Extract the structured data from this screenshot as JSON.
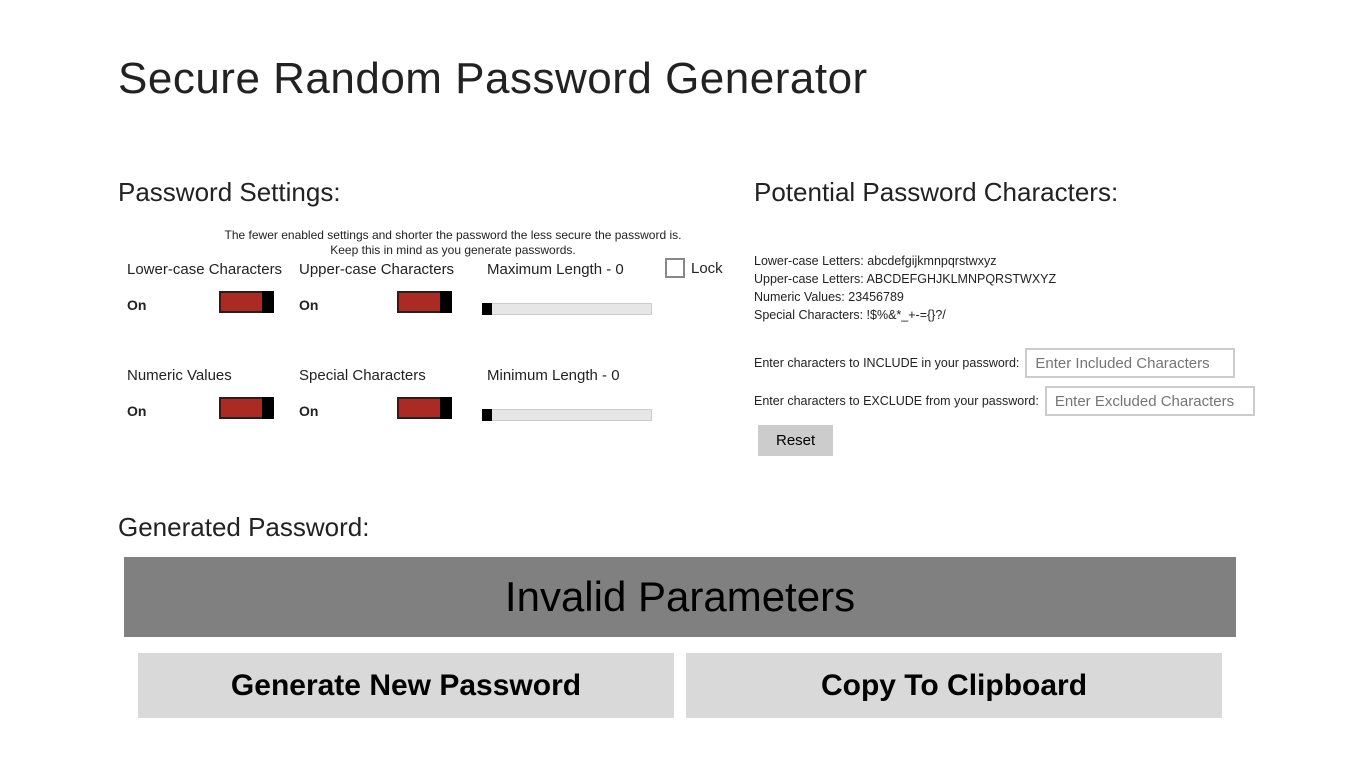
{
  "title": "Secure Random Password Generator",
  "settings": {
    "heading": "Password Settings:",
    "help_line1": "The fewer enabled settings and shorter the password the less secure the password is.",
    "help_line2": "Keep this in mind as you generate passwords.",
    "lowercase": {
      "label": "Lower-case Characters",
      "value": "On"
    },
    "uppercase": {
      "label": "Upper-case Characters",
      "value": "On"
    },
    "numeric": {
      "label": "Numeric Values",
      "value": "On"
    },
    "special": {
      "label": "Special Characters",
      "value": "On"
    },
    "max_length": {
      "label": "Maximum Length - 0"
    },
    "min_length": {
      "label": "Minimum Length - 0"
    },
    "lock_label": "Lock"
  },
  "potential": {
    "heading": "Potential Password Characters:",
    "lowercase": "Lower-case Letters: abcdefgijkmnpqrstwxyz",
    "uppercase": "Upper-case Letters: ABCDEFGHJKLMNPQRSTWXYZ",
    "numeric": "Numeric Values: 23456789",
    "special": "Special Characters: !$%&*_+-={}?/",
    "include_label": "Enter characters to INCLUDE in your password:",
    "include_placeholder": "Enter Included Characters",
    "exclude_label": "Enter characters to EXCLUDE from your password:",
    "exclude_placeholder": "Enter Excluded Characters",
    "reset": "Reset"
  },
  "output": {
    "heading": "Generated Password:",
    "value": "Invalid Parameters",
    "generate": "Generate New Password",
    "copy": "Copy To Clipboard"
  }
}
